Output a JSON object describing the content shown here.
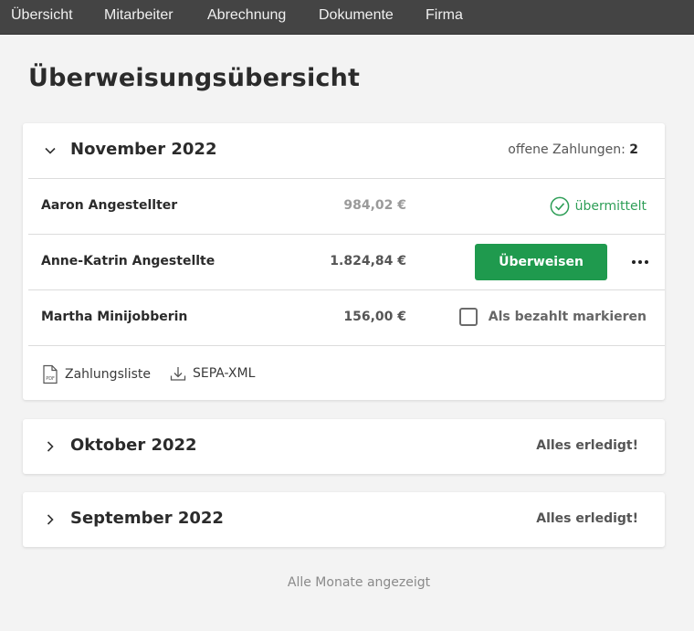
{
  "nav": {
    "items": [
      "Übersicht",
      "Mitarbeiter",
      "Abrechnung",
      "Dokumente",
      "Firma"
    ]
  },
  "page": {
    "title": "Überweisungsübersicht"
  },
  "months": [
    {
      "title": "November 2022",
      "expanded": true,
      "status_label": "offene Zahlungen:",
      "status_count": "2",
      "payments": [
        {
          "name": "Aaron Angestellter",
          "amount": "984,02 €",
          "status": "übermittelt"
        },
        {
          "name": "Anne-Katrin Angestellte",
          "amount": "1.824,84 €",
          "action": "Überweisen"
        },
        {
          "name": "Martha Minijobberin",
          "amount": "156,00 €",
          "action": "Als bezahlt markieren"
        }
      ],
      "downloads": [
        "Zahlungsliste",
        "SEPA-XML"
      ],
      "pdf_badge": "PDF"
    },
    {
      "title": "Oktober 2022",
      "expanded": false,
      "status": "Alles erledigt!"
    },
    {
      "title": "September 2022",
      "expanded": false,
      "status": "Alles erledigt!"
    }
  ],
  "footer": {
    "note": "Alle Monate angezeigt"
  },
  "colors": {
    "nav_bg": "#444444",
    "accent_green": "#1f9a4e",
    "success_text": "#2e9e57",
    "page_bg": "#f3f3f3"
  },
  "icons": [
    "chevron-down-icon",
    "chevron-right-icon",
    "check-circle-icon",
    "more-dots-icon",
    "pdf-file-icon",
    "download-icon"
  ]
}
